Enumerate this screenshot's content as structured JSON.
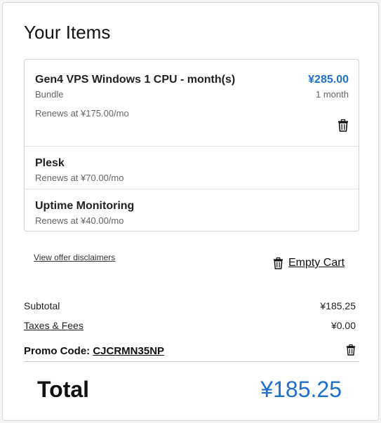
{
  "page": {
    "title": "Your Items"
  },
  "cart": {
    "main_item": {
      "name": "Gen4 VPS Windows 1 CPU - month(s)",
      "type": "Bundle",
      "renewal": "Renews at ¥175.00/mo",
      "price": "¥285.00",
      "term": "1 month",
      "remove_icon": "trash-icon"
    },
    "addons": [
      {
        "name": "Plesk",
        "renewal": "Renews at ¥70.00/mo"
      },
      {
        "name": "Uptime Monitoring",
        "renewal": "Renews at ¥40.00/mo"
      }
    ]
  },
  "links": {
    "disclaimers": "View offer disclaimers",
    "empty_cart": "Empty Cart",
    "empty_cart_icon": "trash-icon"
  },
  "summary": {
    "subtotal_label": "Subtotal",
    "subtotal_value": "¥185.25",
    "taxes_label": "Taxes & Fees",
    "taxes_value": "¥0.00",
    "promo_label": "Promo Code:",
    "promo_code": "CJCRMN35NP",
    "promo_remove_icon": "trash-icon",
    "total_label": "Total",
    "total_value": "¥185.25"
  },
  "colors": {
    "accent": "#1f6fd1",
    "text": "#111111",
    "muted": "#666666",
    "border": "#d4d4d4"
  }
}
